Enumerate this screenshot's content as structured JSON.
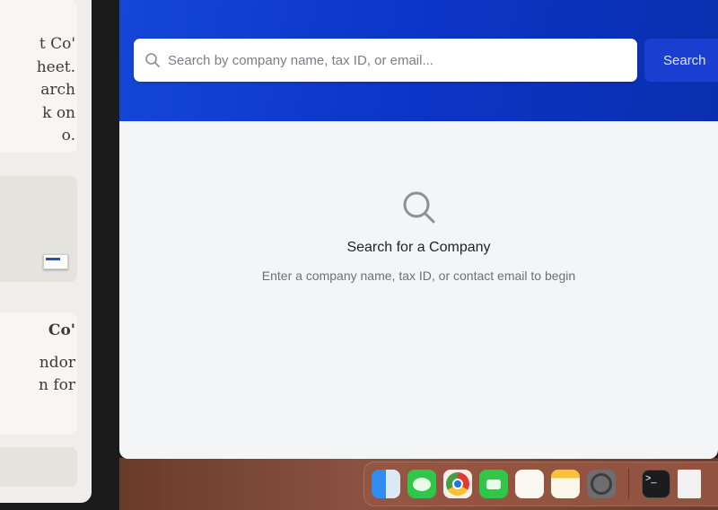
{
  "left_panel": {
    "card1_lines": [
      "t Co'",
      "heet.",
      "arch",
      "k on",
      "o."
    ],
    "card3_title": "Co'",
    "card3_lines": [
      "ndor",
      "n for"
    ]
  },
  "app": {
    "search_placeholder": "Search by company name, tax ID, or email...",
    "search_value": "",
    "search_button": "Search",
    "empty_title": "Search for a Company",
    "empty_subtitle": "Enter a company name, tax ID, or contact email to begin",
    "accent_color": "#1a3fd0"
  },
  "dock": {
    "apps": [
      "finder-icon",
      "messages-icon",
      "chrome-icon",
      "facetime-icon",
      "reminders-icon",
      "notes-icon",
      "system-settings-icon",
      "terminal-icon",
      "zip-file-icon"
    ]
  }
}
